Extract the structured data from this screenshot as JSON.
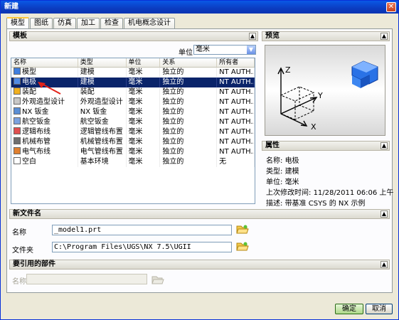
{
  "window": {
    "title": "新建",
    "close_glyph": "✕"
  },
  "tabs": [
    "模型",
    "图纸",
    "仿真",
    "加工",
    "检查",
    "机电概念设计"
  ],
  "templates": {
    "header": "模板",
    "units_label": "单位",
    "units_value": "毫米",
    "columns": [
      "名称",
      "类型",
      "单位",
      "关系",
      "所有者"
    ],
    "rows": [
      {
        "name": "模型",
        "type": "建模",
        "unit": "毫米",
        "relation": "独立的",
        "owner": "NT AUTH...",
        "icon": "model-icon",
        "selected": false
      },
      {
        "name": "电极",
        "type": "建模",
        "unit": "毫米",
        "relation": "独立的",
        "owner": "NT AUTH...",
        "icon": "electrode-icon",
        "selected": true
      },
      {
        "name": "装配",
        "type": "装配",
        "unit": "毫米",
        "relation": "独立的",
        "owner": "NT AUTH...",
        "icon": "assembly-icon",
        "selected": false
      },
      {
        "name": "外观造型设计",
        "type": "外观造型设计",
        "unit": "毫米",
        "relation": "独立的",
        "owner": "NT AUTH...",
        "icon": "shape-studio-icon",
        "selected": false
      },
      {
        "name": "NX 钣金",
        "type": "NX 钣金",
        "unit": "毫米",
        "relation": "独立的",
        "owner": "NT AUTH...",
        "icon": "sheet-metal-icon",
        "selected": false
      },
      {
        "name": "航空钣金",
        "type": "航空钣金",
        "unit": "毫米",
        "relation": "独立的",
        "owner": "NT AUTH...",
        "icon": "aero-sheet-metal-icon",
        "selected": false
      },
      {
        "name": "逻辑布线",
        "type": "逻辑管线布置",
        "unit": "毫米",
        "relation": "独立的",
        "owner": "NT AUTH...",
        "icon": "logical-routing-icon",
        "selected": false
      },
      {
        "name": "机械布管",
        "type": "机械管线布置",
        "unit": "毫米",
        "relation": "独立的",
        "owner": "NT AUTH...",
        "icon": "mechanical-routing-icon",
        "selected": false
      },
      {
        "name": "电气布线",
        "type": "电气管线布置",
        "unit": "毫米",
        "relation": "独立的",
        "owner": "NT AUTH...",
        "icon": "electrical-routing-icon",
        "selected": false
      },
      {
        "name": "空白",
        "type": "基本环境",
        "unit": "毫米",
        "relation": "独立的",
        "owner": "无",
        "icon": "blank-icon",
        "selected": false
      }
    ]
  },
  "preview": {
    "header": "预览"
  },
  "properties": {
    "header": "属性",
    "lines": [
      {
        "label": "名称:",
        "value": "电极"
      },
      {
        "label": "类型:",
        "value": "建模"
      },
      {
        "label": "单位:",
        "value": "毫米"
      },
      {
        "label": "上次修改时间:",
        "value": "11/28/2011 06:06 上午"
      },
      {
        "label": "描述:",
        "value": "带基准 CSYS 的 NX 示例"
      }
    ]
  },
  "new_file": {
    "header": "新文件名",
    "name_label": "名称",
    "name_value": "_model1.prt",
    "folder_label": "文件夹",
    "folder_value": "C:\\Program Files\\UGS\\NX 7.5\\UGII"
  },
  "referenced": {
    "header": "要引用的部件",
    "name_label": "名称"
  },
  "buttons": {
    "ok": "确定",
    "cancel": "取消"
  },
  "colors": {
    "selection": "#0a246a",
    "titlebar": "#0b3cc0",
    "ok_button": "#aed889"
  }
}
